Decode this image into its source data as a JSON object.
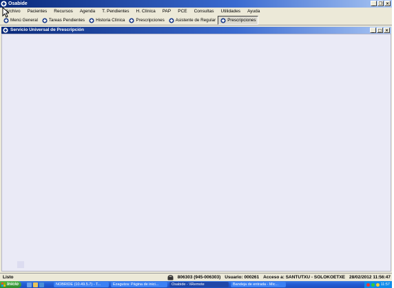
{
  "window": {
    "title": "Osabide",
    "buttons": {
      "minimize": "_",
      "restore": "❐",
      "close": "×"
    }
  },
  "menu": [
    "Archivo",
    "Pacientes",
    "Recursos",
    "Agenda",
    "T. Pendientes",
    "H. Clínica",
    "PAP",
    "PCE",
    "Consultas",
    "Utilidades",
    "Ayuda"
  ],
  "tabs": [
    {
      "label": "Menú General",
      "active": false
    },
    {
      "label": "Tareas Pendientes",
      "active": false
    },
    {
      "label": "Historia Clínica",
      "active": false
    },
    {
      "label": "Prescripciones",
      "active": false
    },
    {
      "label": "Asistente de Regular",
      "active": false
    },
    {
      "label": "Prescripciones",
      "active": true
    }
  ],
  "inner_window": {
    "title": "Servicio Universal de Prescripción",
    "buttons": {
      "minimize": "_",
      "restore": "□",
      "close": "×"
    }
  },
  "status": {
    "left": "Listo",
    "phone": "806303 (945-006303)",
    "user": "Usuario: 000261",
    "access": "Acceso a: SANTUTXU - SOLOKOETXE",
    "datetime": "28/02/2012  11:56:47"
  },
  "taskbar": {
    "start": "Inicio",
    "items": [
      {
        "label": "NOBRIDE (10.49.5.7) - T...",
        "active": false
      },
      {
        "label": "Ezagutza: Página de inici...",
        "active": false
      },
      {
        "label": "Osabide - \\\\Remote",
        "active": true
      },
      {
        "label": "Bandeja de entrada - Mic...",
        "active": false
      }
    ],
    "clock": "11:57"
  },
  "colors": {
    "title_start": "#0a2a7a",
    "title_end": "#a9c6f3",
    "client_bg": "#eaeaf6",
    "chrome": "#ece9d8",
    "taskbar": "#245ed6"
  }
}
